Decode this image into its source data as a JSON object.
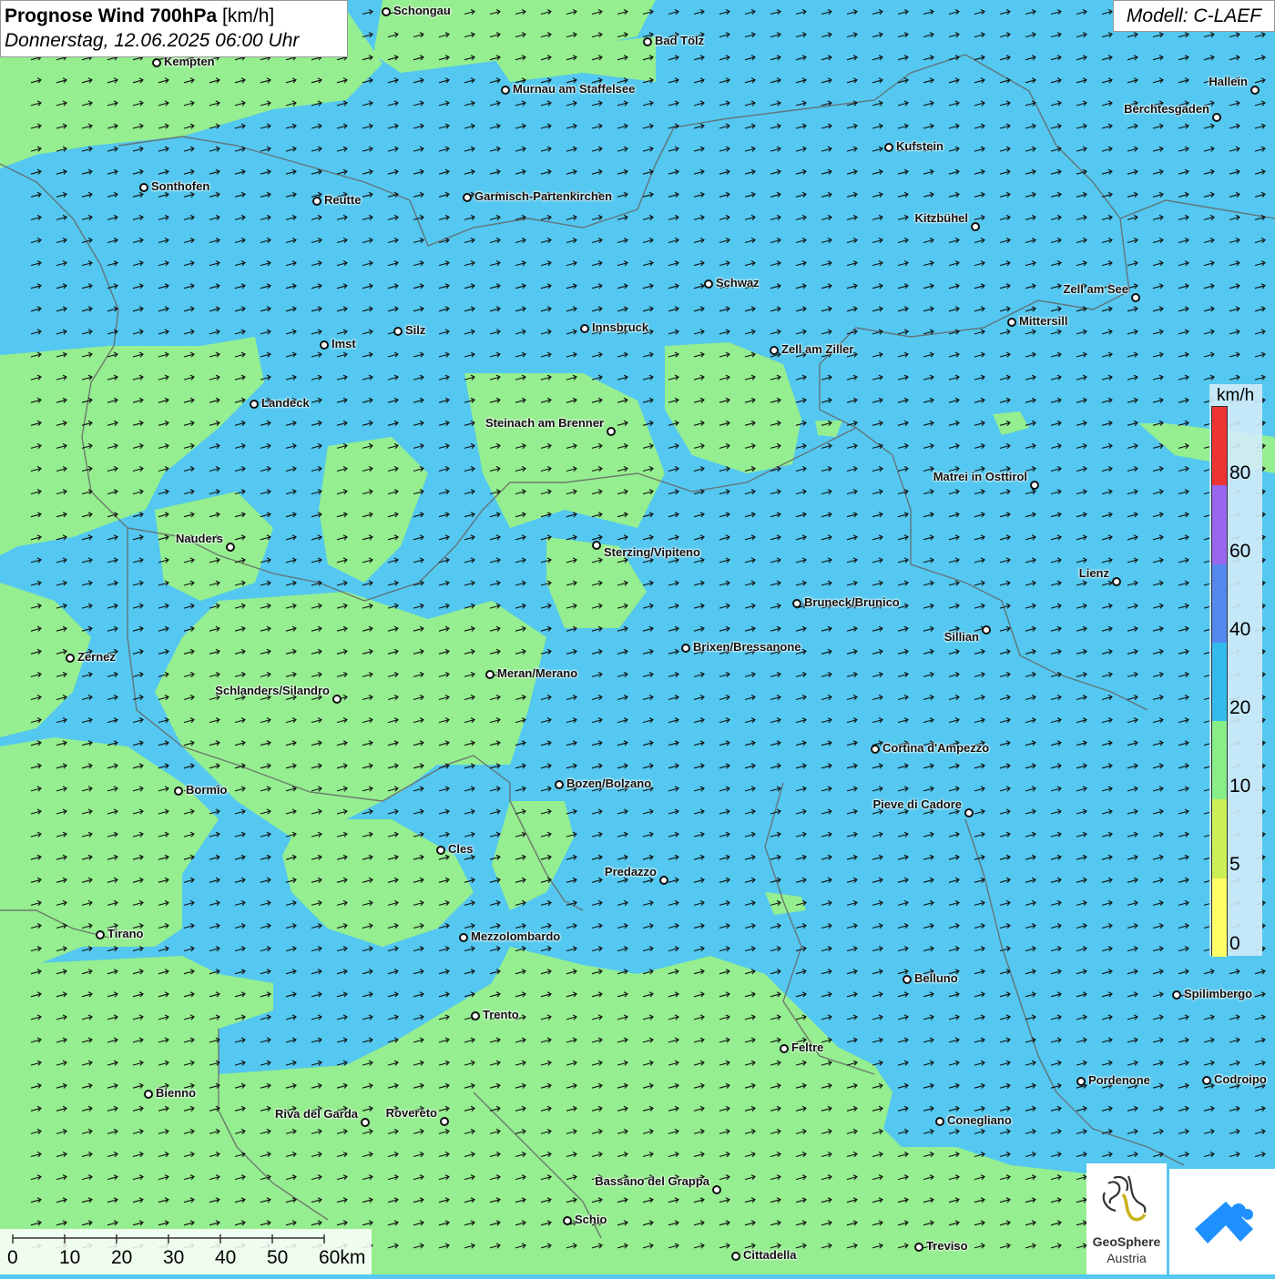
{
  "header": {
    "title_bold": "Prognose Wind 700hPa",
    "title_unit": "[km/h]",
    "datetime": "Donnerstag, 12.06.2025 06:00 Uhr",
    "model": "Modell: C-LAEF"
  },
  "legend": {
    "unit": "km/h",
    "ticks": [
      "80",
      "60",
      "40",
      "20",
      "10",
      "5",
      "0"
    ],
    "colors": [
      "#ee3333",
      "#9966ee",
      "#5588ee",
      "#33bbee",
      "#88ee88",
      "#ccf055",
      "#ffff66"
    ]
  },
  "scale_bar": {
    "labels": [
      "0",
      "10",
      "20",
      "30",
      "40",
      "50",
      "60km"
    ]
  },
  "logos": {
    "geosphere_line1": "GeoSphere",
    "geosphere_line2": "Austria"
  },
  "wind_direction": "east",
  "cities": [
    {
      "name": "Schongau"
    },
    {
      "name": "Kempten"
    },
    {
      "name": "Bad Tölz"
    },
    {
      "name": "Murnau am Staffelsee"
    },
    {
      "name": "Hallein"
    },
    {
      "name": "Berchtesgaden"
    },
    {
      "name": "Kufstein"
    },
    {
      "name": "Sonthofen"
    },
    {
      "name": "Reutte"
    },
    {
      "name": "Garmisch-Partenkirchen"
    },
    {
      "name": "Kitzbühel"
    },
    {
      "name": "Schwaz"
    },
    {
      "name": "Zell am See"
    },
    {
      "name": "Mittersill"
    },
    {
      "name": "Imst"
    },
    {
      "name": "Silz"
    },
    {
      "name": "Innsbruck"
    },
    {
      "name": "Zell am Ziller"
    },
    {
      "name": "Landeck"
    },
    {
      "name": "Steinach am Brenner"
    },
    {
      "name": "Matrei in Osttirol"
    },
    {
      "name": "Nauders"
    },
    {
      "name": "Sterzing/Vipiteno"
    },
    {
      "name": "Lienz"
    },
    {
      "name": "Bruneck/Brunico"
    },
    {
      "name": "Sillian"
    },
    {
      "name": "Brixen/Bressanone"
    },
    {
      "name": "Zernez"
    },
    {
      "name": "Meran/Merano"
    },
    {
      "name": "Schlanders/Silandro"
    },
    {
      "name": "Cortina d'Ampezzo"
    },
    {
      "name": "Bozen/Bolzano"
    },
    {
      "name": "Bormio"
    },
    {
      "name": "Pieve di Cadore"
    },
    {
      "name": "Cles"
    },
    {
      "name": "Predazzo"
    },
    {
      "name": "Tirano"
    },
    {
      "name": "Mezzolombardo"
    },
    {
      "name": "Belluno"
    },
    {
      "name": "Spilimbergo"
    },
    {
      "name": "Trento"
    },
    {
      "name": "Feltre"
    },
    {
      "name": "Pordenone"
    },
    {
      "name": "Codroipo"
    },
    {
      "name": "Bienno"
    },
    {
      "name": "Riva del Garda"
    },
    {
      "name": "Rovereto"
    },
    {
      "name": "Conegliano"
    },
    {
      "name": "Bassano del Grappa"
    },
    {
      "name": "Schio"
    },
    {
      "name": "Treviso"
    },
    {
      "name": "Cittadella"
    }
  ]
}
